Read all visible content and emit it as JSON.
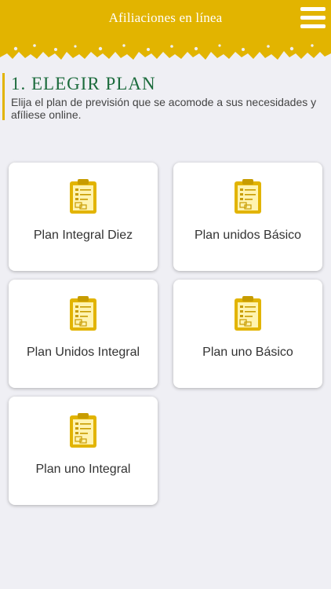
{
  "header": {
    "title": "Afiliaciones en línea",
    "menu_icon": "hamburger-menu-icon",
    "color": "#e2b400"
  },
  "section": {
    "title": "1. ELEGIR PLAN",
    "description": "Elija el plan de previsión que se acomode a sus necesidades y afíliese online.",
    "accent_color": "#1b6b3c"
  },
  "plans": [
    {
      "label": "Plan Integral Diez",
      "icon": "clipboard-icon"
    },
    {
      "label": "Plan unidos Básico",
      "icon": "clipboard-icon"
    },
    {
      "label": "Plan Unidos Integral",
      "icon": "clipboard-icon"
    },
    {
      "label": "Plan uno Básico",
      "icon": "clipboard-icon"
    },
    {
      "label": "Plan uno Integral",
      "icon": "clipboard-icon"
    }
  ]
}
